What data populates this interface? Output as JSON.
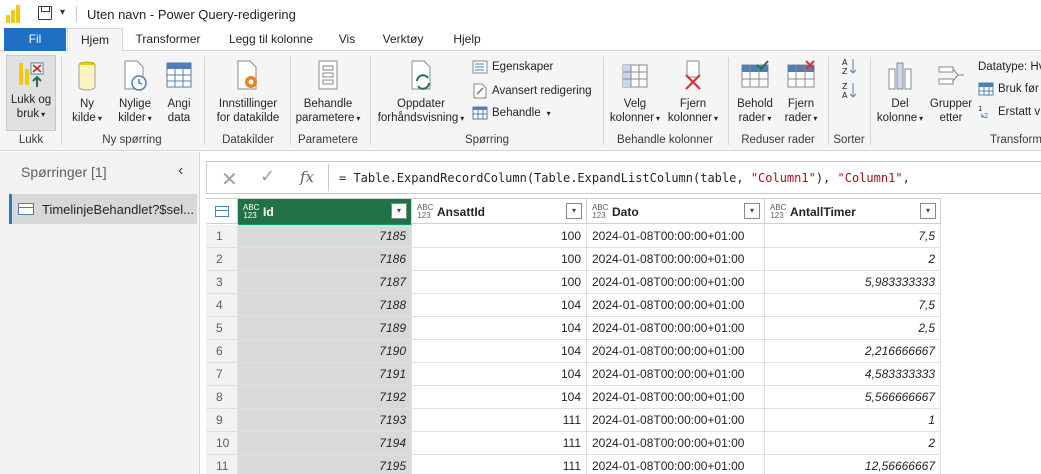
{
  "app": {
    "title": "Uten navn - Power Query-redigering",
    "qat_dropdown": "▾"
  },
  "tabs": [
    {
      "label": "Fil"
    },
    {
      "label": "Hjem"
    },
    {
      "label": "Transformer"
    },
    {
      "label": "Legg til kolonne"
    },
    {
      "label": "Vis"
    },
    {
      "label": "Verktøy"
    },
    {
      "label": "Hjelp"
    }
  ],
  "ribbon": {
    "groups": {
      "lukk": "Lukk",
      "ny_sporring": "Ny spørring",
      "datakilder": "Datakilder",
      "parametere": "Parametere",
      "sporring": "Spørring",
      "behandle_kolonner": "Behandle kolonner",
      "reduser_rader": "Reduser rader",
      "sorter": "Sorter",
      "transform": "Transform"
    },
    "buttons": {
      "lukk_og_bruk_1": "Lukk og",
      "lukk_og_bruk_2": "bruk",
      "ny_kilde_1": "Ny",
      "ny_kilde_2": "kilde",
      "nylige_kilder_1": "Nylige",
      "nylige_kilder_2": "kilder",
      "angi_data_1": "Angi",
      "angi_data_2": "data",
      "innstillinger_1": "Innstillinger",
      "innstillinger_2": "for datakilde",
      "behandle_param_1": "Behandle",
      "behandle_param_2": "parametere",
      "oppdater_1": "Oppdater",
      "oppdater_2": "forhåndsvisning",
      "egenskaper": "Egenskaper",
      "avansert": "Avansert redigering",
      "behandle": "Behandle",
      "velg_kolonner_1": "Velg",
      "velg_kolonner_2": "kolonner",
      "fjern_kolonner_1": "Fjern",
      "fjern_kolonner_2": "kolonner",
      "behold_rader_1": "Behold",
      "behold_rader_2": "rader",
      "fjern_rader_1": "Fjern",
      "fjern_rader_2": "rader",
      "del_kolonne_1": "Del",
      "del_kolonne_2": "kolonne",
      "grupper_etter_1": "Grupper",
      "grupper_etter_2": "etter",
      "datatype": "Datatype: Hv",
      "bruk_forste": "Bruk før",
      "erstatt": "Erstatt v",
      "caret": "▾"
    }
  },
  "query_panel": {
    "title": "Spørringer [1]",
    "collapse": "‹",
    "items": [
      {
        "label": "TimelinjeBehandlet?$sel..."
      }
    ]
  },
  "formula_bar": {
    "cancel": "✕",
    "confirm": "✓",
    "fx": "fx",
    "parts": {
      "p1": "= Table.ExpandRecordColumn(Table.ExpandListColumn(table, ",
      "s1": "\"Column1\"",
      "p2": "), ",
      "s2": "\"Column1\"",
      "p3": ","
    }
  },
  "table": {
    "type_icon": "ABC\n123",
    "filter_icon": "▾",
    "columns": [
      {
        "name": "Id"
      },
      {
        "name": "AnsattId"
      },
      {
        "name": "Dato"
      },
      {
        "name": "AntallTimer"
      }
    ],
    "rows": [
      {
        "n": "1",
        "id": "7185",
        "ansatt": "100",
        "dato": "2024-01-08T00:00:00+01:00",
        "timer": "7,5"
      },
      {
        "n": "2",
        "id": "7186",
        "ansatt": "100",
        "dato": "2024-01-08T00:00:00+01:00",
        "timer": "2"
      },
      {
        "n": "3",
        "id": "7187",
        "ansatt": "100",
        "dato": "2024-01-08T00:00:00+01:00",
        "timer": "5,983333333"
      },
      {
        "n": "4",
        "id": "7188",
        "ansatt": "104",
        "dato": "2024-01-08T00:00:00+01:00",
        "timer": "7,5"
      },
      {
        "n": "5",
        "id": "7189",
        "ansatt": "104",
        "dato": "2024-01-08T00:00:00+01:00",
        "timer": "2,5"
      },
      {
        "n": "6",
        "id": "7190",
        "ansatt": "104",
        "dato": "2024-01-08T00:00:00+01:00",
        "timer": "2,216666667"
      },
      {
        "n": "7",
        "id": "7191",
        "ansatt": "104",
        "dato": "2024-01-08T00:00:00+01:00",
        "timer": "4,583333333"
      },
      {
        "n": "8",
        "id": "7192",
        "ansatt": "104",
        "dato": "2024-01-08T00:00:00+01:00",
        "timer": "5,566666667"
      },
      {
        "n": "9",
        "id": "7193",
        "ansatt": "111",
        "dato": "2024-01-08T00:00:00+01:00",
        "timer": "1"
      },
      {
        "n": "10",
        "id": "7194",
        "ansatt": "111",
        "dato": "2024-01-08T00:00:00+01:00",
        "timer": "2"
      },
      {
        "n": "11",
        "id": "7195",
        "ansatt": "111",
        "dato": "2024-01-08T00:00:00+01:00",
        "timer": "12,56666667"
      }
    ]
  },
  "colors": {
    "file_tab": "#1f6fc5",
    "selected_column": "#217346",
    "accent_green": "#0b9e5d",
    "logo_yellow": "#f2c811"
  }
}
